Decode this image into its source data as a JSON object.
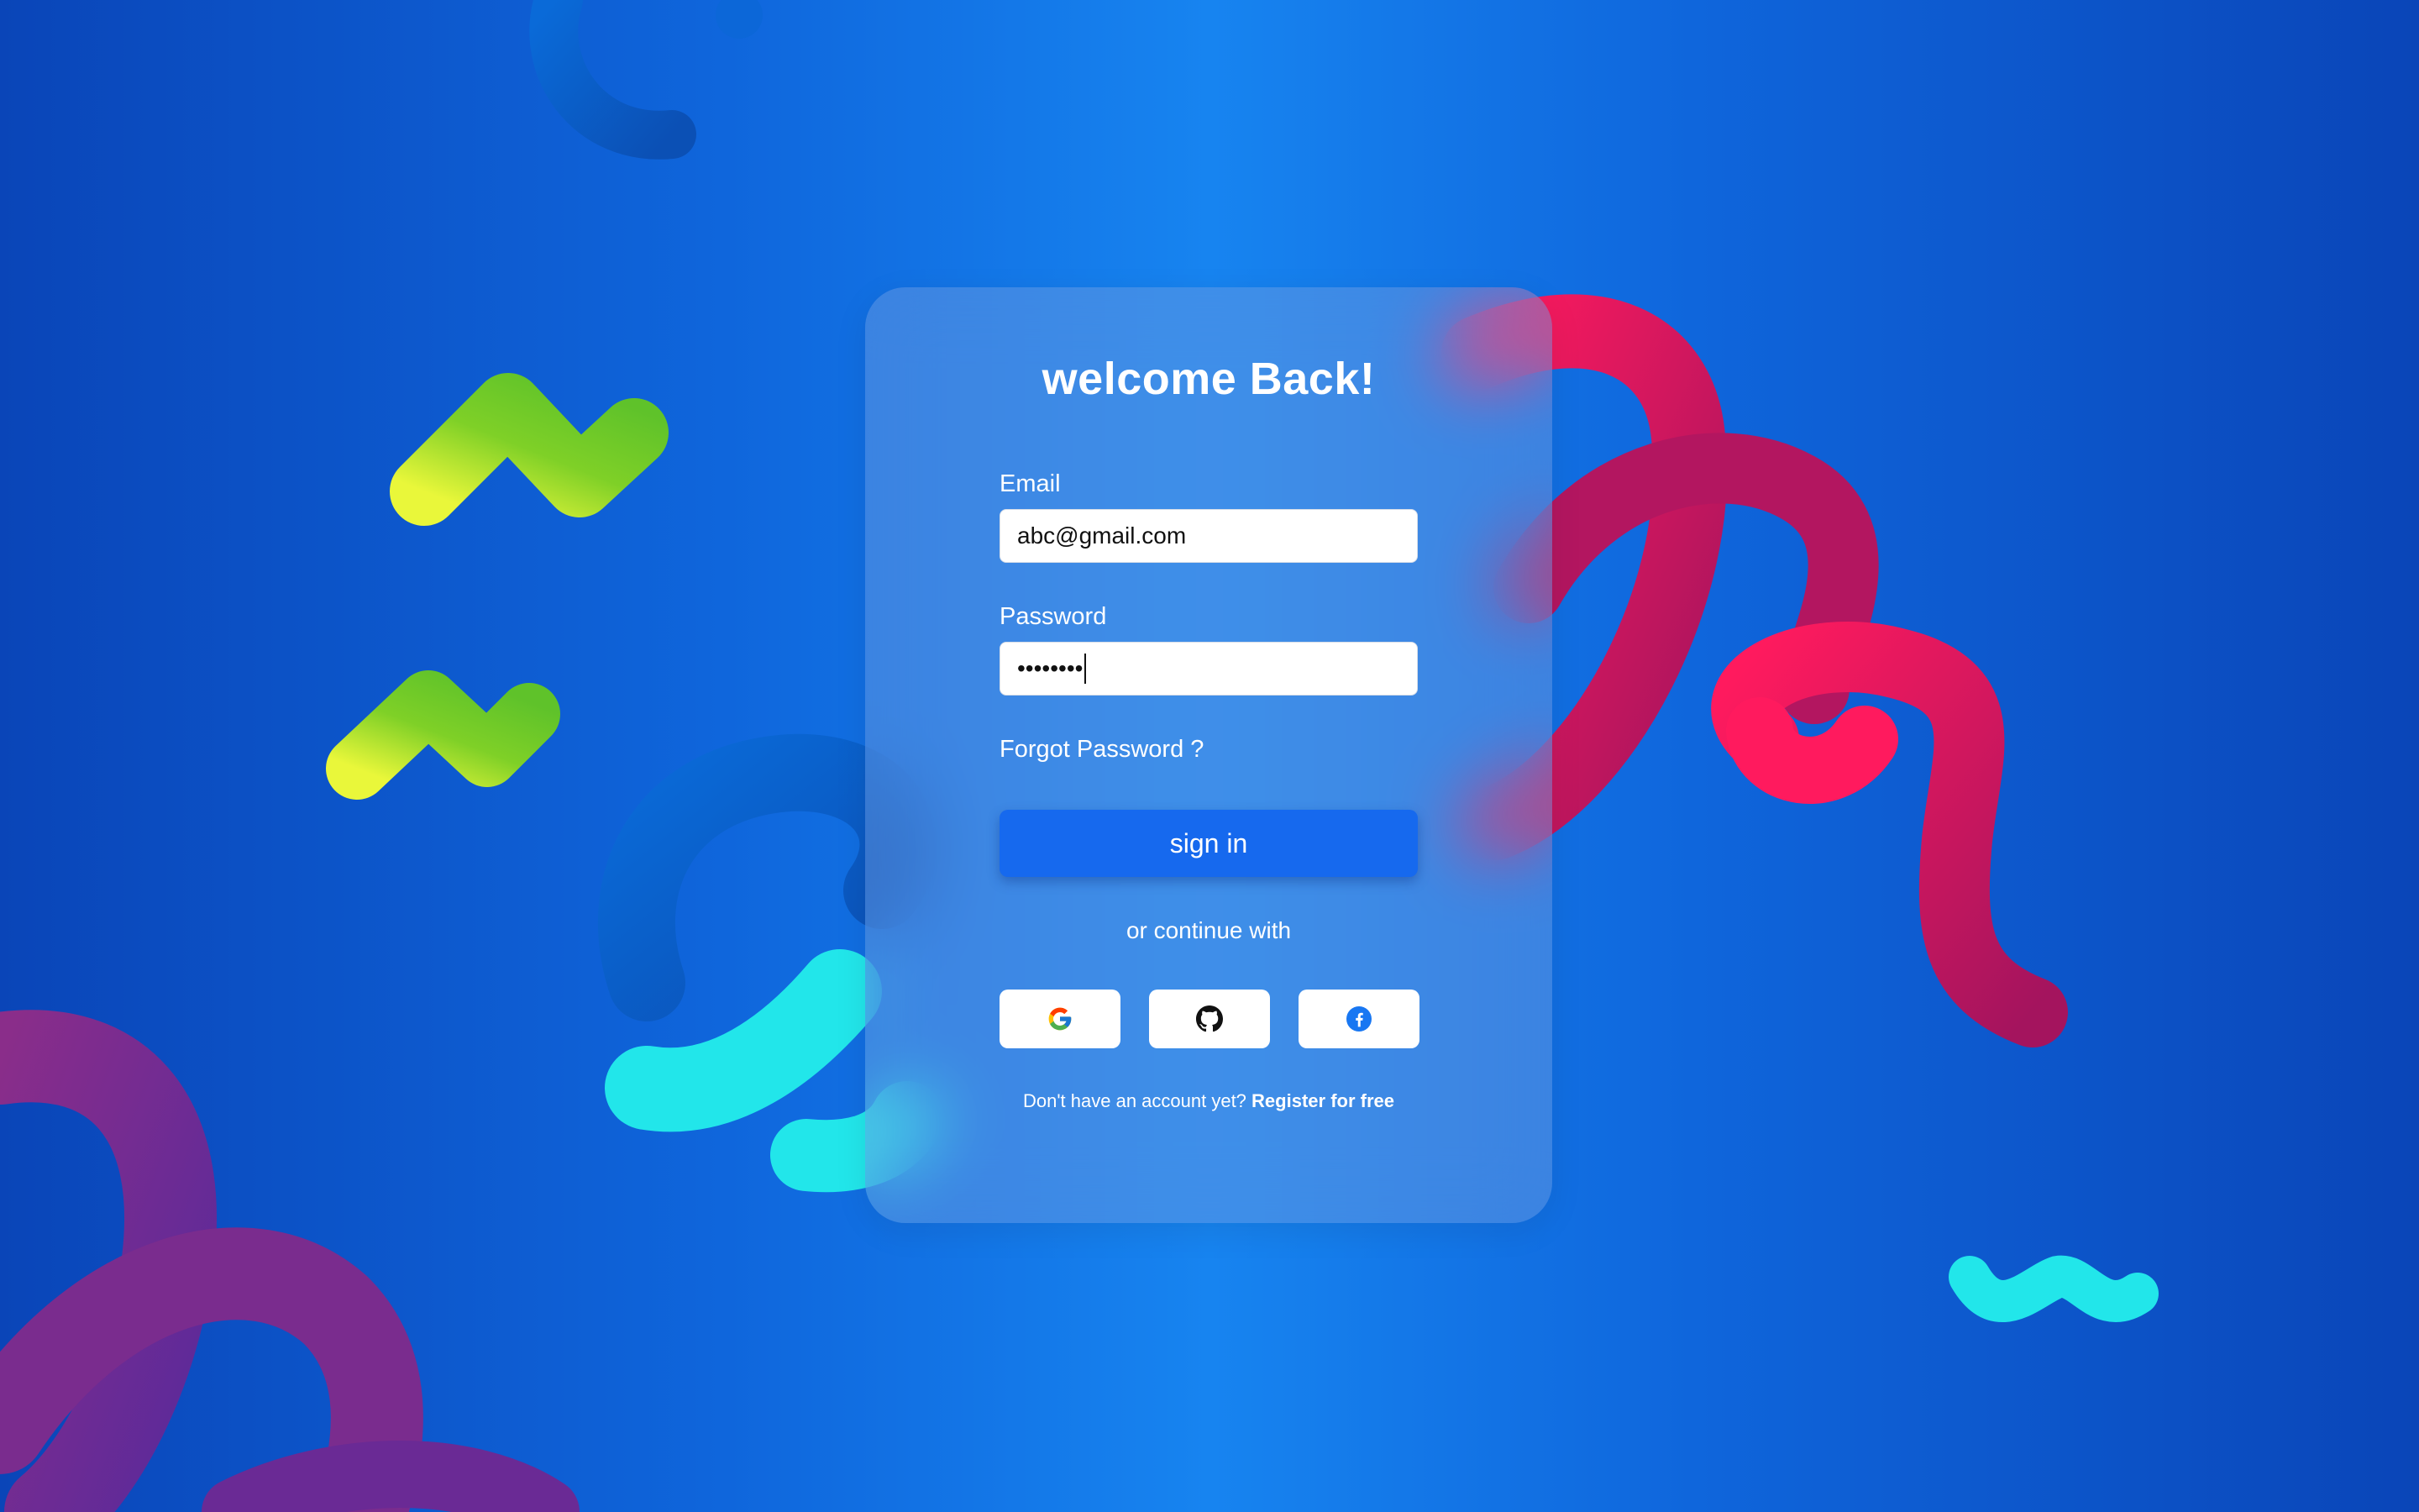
{
  "login": {
    "title": "welcome Back!",
    "email_label": "Email",
    "email_value": "abc@gmail.com",
    "password_label": "Password",
    "password_value": "••••••••",
    "forgot_password": "Forgot Password ?",
    "sign_in_button": "sign in",
    "divider_text": "or continue with",
    "social_buttons": [
      {
        "name": "google",
        "icon": "google-icon"
      },
      {
        "name": "github",
        "icon": "github-icon"
      },
      {
        "name": "facebook",
        "icon": "facebook-icon"
      }
    ],
    "register_prompt": "Don't have an account yet?",
    "register_link": "Register for free"
  },
  "colors": {
    "primary": "#1669ee",
    "background_center": "#1784f0",
    "background_edge": "#0a45b8"
  }
}
